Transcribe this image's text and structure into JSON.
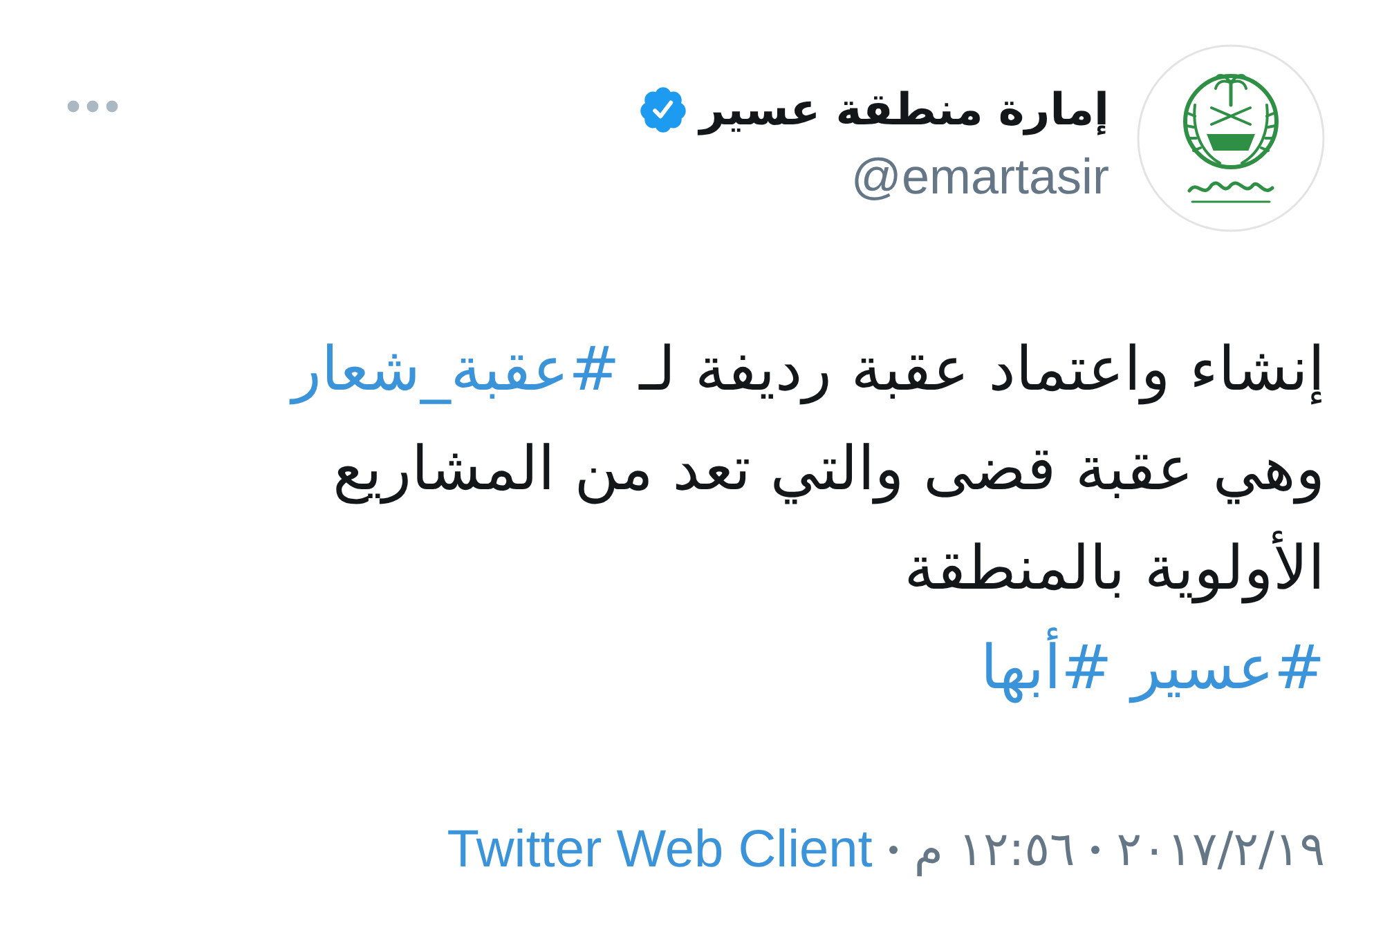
{
  "account": {
    "name": "إمارة منطقة عسير",
    "handle": "@emartasir",
    "verified": true
  },
  "tweet": {
    "lines": [
      [
        {
          "kind": "text",
          "text": "إنشاء واعتماد عقبة رديفة لـ"
        },
        {
          "kind": "hashtag",
          "text": "#عقبة_شعار"
        }
      ],
      [
        {
          "kind": "text",
          "text": "وهي عقبة قضى والتي تعد من المشاريع"
        }
      ],
      [
        {
          "kind": "text",
          "text": "الأولوية بالمنطقة"
        }
      ],
      [
        {
          "kind": "hashtag",
          "text": "#عسير"
        },
        {
          "kind": "hashtag",
          "text": "#أبها"
        }
      ]
    ]
  },
  "meta": {
    "date": "٢٠١٧/٢/١٩",
    "time": "١٢:٥٦ م",
    "source": "Twitter Web Client"
  }
}
